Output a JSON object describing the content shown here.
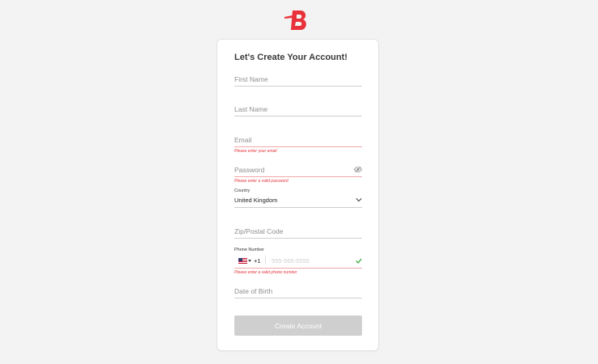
{
  "brand": {
    "logo_icon": "brand-b-logo-icon",
    "accent_color": "#e8313a"
  },
  "form": {
    "title": "Let's Create Your Account!",
    "first_name": {
      "placeholder": "First Name"
    },
    "last_name": {
      "placeholder": "Last Name"
    },
    "email": {
      "placeholder": "Email",
      "error": "Please enter your email"
    },
    "password": {
      "placeholder": "Password",
      "error": "Please enter a valid password",
      "toggle_icon": "eye-icon"
    },
    "country": {
      "label": "Country",
      "value": "United Kingdom",
      "dropdown_icon": "chevron-down-icon"
    },
    "zip": {
      "placeholder": "Zip/Postal Code"
    },
    "phone": {
      "label": "Phone Number",
      "flag_icon": "us-flag-icon",
      "dial_code": "+1",
      "placeholder": "555-555-5555",
      "valid_icon": "checkmark-icon",
      "error": "Please enter a valid phone number"
    },
    "dob": {
      "placeholder": "Date of Birth"
    },
    "submit_label": "Create Account"
  },
  "colors": {
    "error": "#e5343a",
    "success": "#4caf50",
    "button_disabled": "#cfcfcf"
  }
}
